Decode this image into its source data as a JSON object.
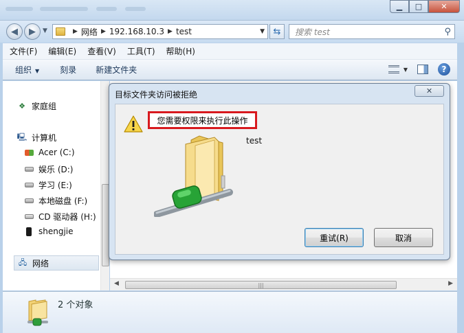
{
  "search": {
    "placeholder": "搜索 test"
  },
  "address": {
    "segments": [
      "网络",
      "192.168.10.3",
      "test"
    ]
  },
  "menu": [
    "文件(F)",
    "编辑(E)",
    "查看(V)",
    "工具(T)",
    "帮助(H)"
  ],
  "toolbar": {
    "organize": "组织",
    "burn": "刻录",
    "new_folder": "新建文件夹"
  },
  "nav": {
    "homegroup": "家庭组",
    "computer": "计算机",
    "drives": [
      "Acer (C:)",
      "娱乐 (D:)",
      "学习 (E:)",
      "本地磁盘 (F:)",
      "CD 驱动器 (H:)",
      "shengjie"
    ],
    "network": "网络"
  },
  "dialog": {
    "title": "目标文件夹访问被拒绝",
    "message": "您需要权限来执行此操作",
    "item_name": "test",
    "retry_label": "重试(R)",
    "cancel_label": "取消"
  },
  "status": {
    "count": "2 个对象"
  },
  "colors": {
    "highlight_border": "#d8191e",
    "window_frame": "#b9d1ea"
  }
}
